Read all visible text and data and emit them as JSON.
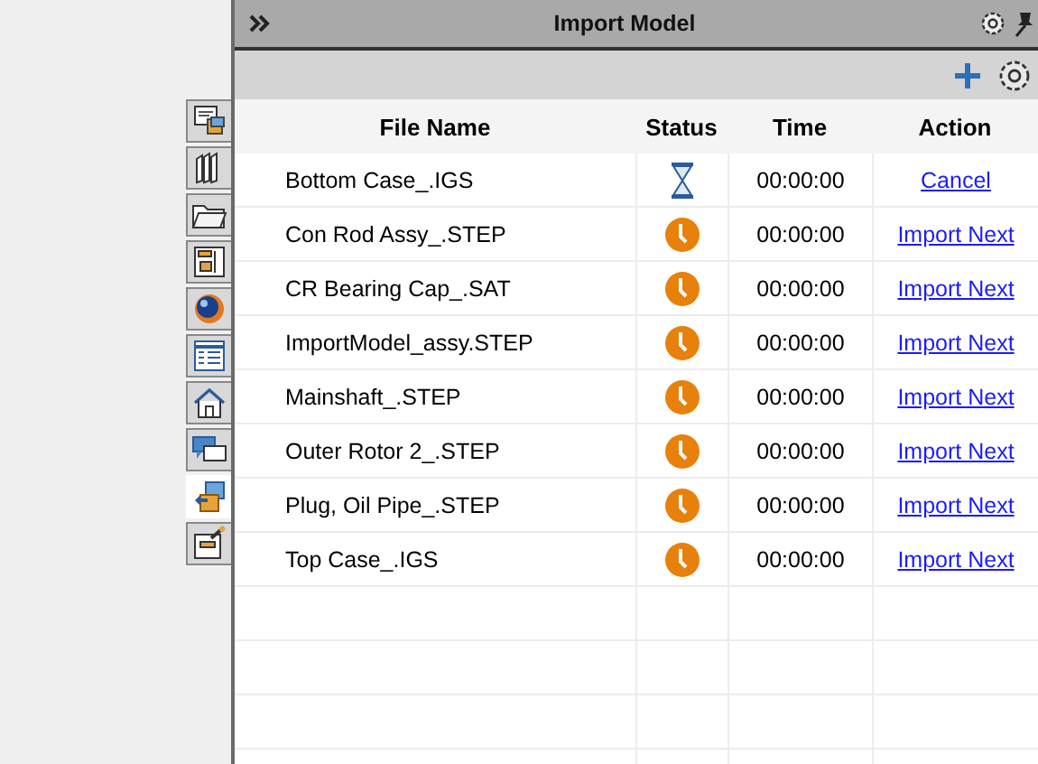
{
  "side_tabs": [
    {
      "selected": false
    },
    {
      "selected": false
    },
    {
      "selected": false
    },
    {
      "selected": false
    },
    {
      "selected": false
    },
    {
      "selected": false
    },
    {
      "selected": false
    },
    {
      "selected": false
    },
    {
      "selected": true
    },
    {
      "selected": false
    }
  ],
  "window": {
    "title": "Import Model"
  },
  "table": {
    "columns": [
      "File Name",
      "Status",
      "Time",
      "Action"
    ],
    "rows": [
      {
        "kind": "running",
        "file": "Bottom Case_.IGS",
        "time": "00:00:00",
        "action": "Cancel"
      },
      {
        "kind": "queued",
        "file": "Con Rod Assy_.STEP",
        "time": "00:00:00",
        "action": "Import Next"
      },
      {
        "kind": "queued",
        "file": "CR Bearing Cap_.SAT",
        "time": "00:00:00",
        "action": "Import Next"
      },
      {
        "kind": "queued",
        "file": "ImportModel_assy.STEP",
        "time": "00:00:00",
        "action": "Import Next"
      },
      {
        "kind": "queued",
        "file": "Mainshaft_.STEP",
        "time": "00:00:00",
        "action": "Import Next"
      },
      {
        "kind": "queued",
        "file": "Outer Rotor 2_.STEP",
        "time": "00:00:00",
        "action": "Import Next"
      },
      {
        "kind": "queued",
        "file": "Plug, Oil Pipe_.STEP",
        "time": "00:00:00",
        "action": "Import Next"
      },
      {
        "kind": "queued",
        "file": "Top Case_.IGS",
        "time": "00:00:00",
        "action": "Import Next"
      }
    ]
  }
}
